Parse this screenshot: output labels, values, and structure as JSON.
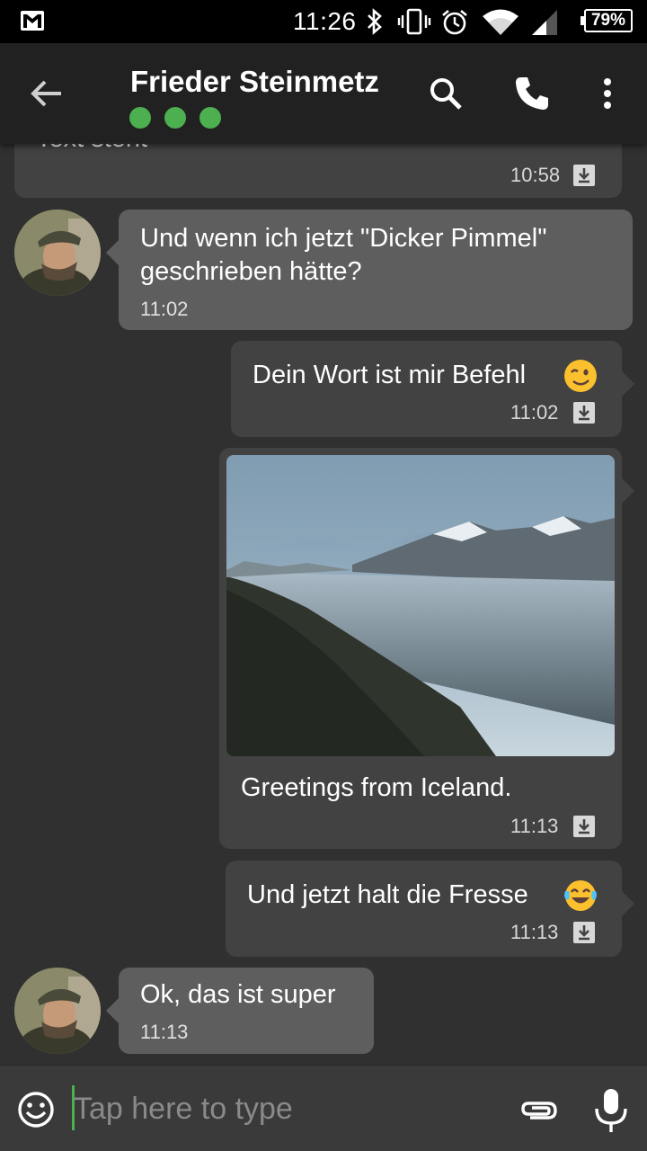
{
  "status_bar": {
    "time": "11:26",
    "battery": "79%",
    "icons": [
      "gmail-icon",
      "bluetooth-icon",
      "vibrate-icon",
      "alarm-icon",
      "wifi-icon",
      "signal-icon",
      "battery-icon"
    ]
  },
  "header": {
    "contact_name": "Frieder Steinmetz",
    "status_dot_color": "#4caf50",
    "actions": [
      "search-icon",
      "phone-icon",
      "more-vert-icon"
    ]
  },
  "messages": [
    {
      "direction": "out",
      "text": "Text steht",
      "time": "10:58"
    },
    {
      "direction": "in",
      "text_lines": [
        "Und wenn ich jetzt \"Dicker Pimmel\"",
        "geschrieben hätte?"
      ],
      "time": "11:02"
    },
    {
      "direction": "out",
      "text": "Dein Wort ist mir Befehl",
      "emoji": "😉",
      "time": "11:02"
    },
    {
      "direction": "out",
      "type": "image",
      "caption": "Greetings from Iceland.",
      "time": "11:13"
    },
    {
      "direction": "out",
      "text": "Und jetzt halt die Fresse",
      "emoji": "😂",
      "time": "11:13"
    },
    {
      "direction": "in",
      "text": "Ok, das ist super",
      "time": "11:13"
    }
  ],
  "composer": {
    "placeholder": "Tap here to type"
  },
  "colors": {
    "background": "#303030",
    "incoming_bubble": "#5e5e5e",
    "outgoing_bubble": "#424242",
    "accent": "#4caf50"
  }
}
